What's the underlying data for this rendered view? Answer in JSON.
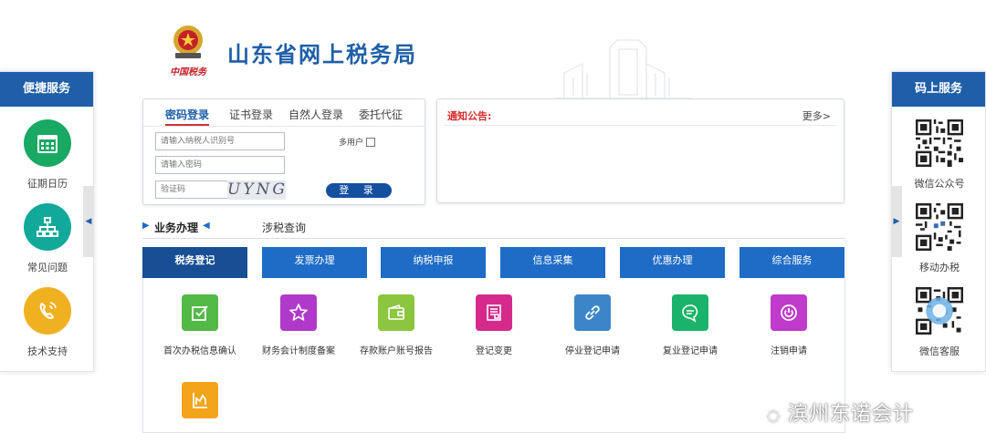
{
  "header": {
    "title": "山东省网上税务局",
    "emblem_caption": "中国税务"
  },
  "left_panel": {
    "title": "便捷服务",
    "items": [
      {
        "label": "征期日历",
        "icon": "calendar-icon",
        "color": "#1aa963"
      },
      {
        "label": "常见问题",
        "icon": "sitemap-icon",
        "color": "#12a99b"
      },
      {
        "label": "技术支持",
        "icon": "phone-icon",
        "color": "#f0b121"
      }
    ],
    "toggle": "◀"
  },
  "right_panel": {
    "title": "码上服务",
    "items": [
      {
        "label": "微信公众号",
        "icon": "qr-code-icon"
      },
      {
        "label": "移动办税",
        "icon": "qr-code-icon"
      },
      {
        "label": "微信客服",
        "icon": "qr-code-icon"
      }
    ],
    "toggle": "▶"
  },
  "login": {
    "tabs": [
      "密码登录",
      "证书登录",
      "自然人登录",
      "委托代征"
    ],
    "active_tab": "密码登录",
    "taxpayer_placeholder": "请输入纳税人识别号",
    "password_placeholder": "请输入密码",
    "captcha_placeholder": "验证码",
    "captcha_text": "UYNG",
    "multi_user_label": "多用户",
    "login_button": "登 录"
  },
  "notice": {
    "title": "通知公告:",
    "more": "更多>"
  },
  "business": {
    "tab_active": "业务办理",
    "tab_other": "涉税查询",
    "arrow_left": "▶",
    "arrow_right": "◀",
    "categories": [
      "税务登记",
      "发票办理",
      "纳税申报",
      "信息采集",
      "优惠办理",
      "综合服务"
    ],
    "active_category": "税务登记",
    "items": [
      {
        "label": "首次办税信息确认",
        "icon": "checkbox-edit-icon",
        "color": "#53b946"
      },
      {
        "label": "财务会计制度备案",
        "icon": "star-icon",
        "color": "#b139c9"
      },
      {
        "label": "存款账户账号报告",
        "icon": "wallet-icon",
        "color": "#8cc63f"
      },
      {
        "label": "登记变更",
        "icon": "document-icon",
        "color": "#d52a8c"
      },
      {
        "label": "停业登记申请",
        "icon": "link-icon",
        "color": "#3b86c9"
      },
      {
        "label": "复业登记申请",
        "icon": "chat-icon",
        "color": "#1bb36b"
      },
      {
        "label": "注销申请",
        "icon": "power-icon",
        "color": "#c03acb"
      },
      {
        "label": "",
        "icon": "chart-icon",
        "color": "#f3a41b"
      }
    ]
  },
  "watermark": "滨州东诺会计"
}
